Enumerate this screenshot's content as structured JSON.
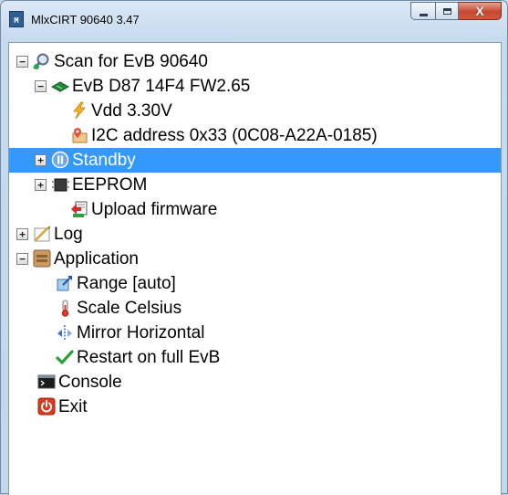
{
  "window": {
    "title": "MlxCIRT 90640 3.47",
    "app_icon_text": "M",
    "close_glyph": "X"
  },
  "tree": {
    "items": [
      {
        "label": "Scan for EvB 90640",
        "icon": "magnifier-icon",
        "expander": "−",
        "level": 0,
        "selected": false
      },
      {
        "label": "EvB D87 14F4 FW2.65",
        "icon": "board-icon",
        "expander": "−",
        "level": 1,
        "selected": false
      },
      {
        "label": "Vdd 3.30V",
        "icon": "lightning-icon",
        "expander": "",
        "level": 2,
        "selected": false
      },
      {
        "label": "I2C address 0x33 (0C08-A22A-0185)",
        "icon": "address-pin-icon",
        "expander": "",
        "level": 2,
        "selected": false
      },
      {
        "label": "Standby",
        "icon": "pause-icon",
        "expander": "+",
        "level": 1,
        "selected": true
      },
      {
        "label": "EEPROM",
        "icon": "chip-icon",
        "expander": "+",
        "level": 1,
        "selected": false
      },
      {
        "label": "Upload firmware",
        "icon": "upload-icon",
        "expander": "",
        "level": 2,
        "selected": false
      },
      {
        "label": "Log",
        "icon": "log-icon",
        "expander": "+",
        "level": 0,
        "selected": false
      },
      {
        "label": "Application",
        "icon": "application-icon",
        "expander": "−",
        "level": 0,
        "selected": false
      },
      {
        "label": "Range [auto]",
        "icon": "range-icon",
        "expander": "",
        "level": 1,
        "selected": false
      },
      {
        "label": "Scale Celsius",
        "icon": "thermometer-icon",
        "expander": "",
        "level": 1,
        "selected": false
      },
      {
        "label": "Mirror Horizontal",
        "icon": "mirror-icon",
        "expander": "",
        "level": 1,
        "selected": false
      },
      {
        "label": "Restart on full EvB",
        "icon": "checkmark-icon",
        "expander": "",
        "level": 1,
        "selected": false
      },
      {
        "label": "Console",
        "icon": "console-icon",
        "expander": "",
        "level": 0,
        "selected": false
      },
      {
        "label": "Exit",
        "icon": "power-icon",
        "expander": "",
        "level": 0,
        "selected": false
      }
    ]
  }
}
